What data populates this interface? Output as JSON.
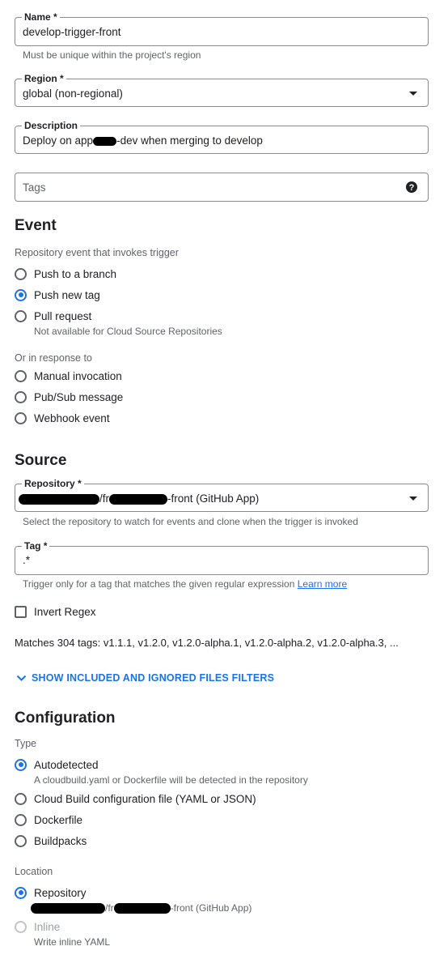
{
  "name_field": {
    "label": "Name *",
    "value": "develop-trigger-front",
    "help": "Must be unique within the project's region"
  },
  "region_field": {
    "label": "Region *",
    "value": "global (non-regional)"
  },
  "description_field": {
    "label": "Description",
    "value_prefix": "Deploy on app",
    "value_suffix": "-dev when merging to develop"
  },
  "tags_field": {
    "placeholder": "Tags",
    "help_icon": "question-circle-icon"
  },
  "event": {
    "title": "Event",
    "subtitle": "Repository event that invokes trigger",
    "options": [
      {
        "label": "Push to a branch",
        "selected": false
      },
      {
        "label": "Push new tag",
        "selected": true
      },
      {
        "label": "Pull request",
        "selected": false,
        "note": "Not available for Cloud Source Repositories"
      }
    ],
    "response_subtitle": "Or in response to",
    "response_options": [
      {
        "label": "Manual invocation",
        "selected": false
      },
      {
        "label": "Pub/Sub message",
        "selected": false
      },
      {
        "label": "Webhook event",
        "selected": false
      }
    ]
  },
  "source": {
    "title": "Source",
    "repository": {
      "label": "Repository *",
      "value_mid": "/fr",
      "value_suffix": "-front (GitHub App)",
      "help": "Select the repository to watch for events and clone when the trigger is invoked"
    },
    "tag": {
      "label": "Tag *",
      "value": ".*",
      "help": "Trigger only for a tag that matches the given regular expression",
      "learn_more": "Learn more"
    },
    "invert_regex": {
      "label": "Invert Regex",
      "checked": false
    },
    "matches": "Matches 304 tags: v1.1.1, v1.2.0, v1.2.0-alpha.1, v1.2.0-alpha.2, v1.2.0-alpha.3, ...",
    "filters_toggle": "SHOW INCLUDED AND IGNORED FILES FILTERS"
  },
  "configuration": {
    "title": "Configuration",
    "type_label": "Type",
    "types": [
      {
        "label": "Autodetected",
        "selected": true,
        "note": "A cloudbuild.yaml or Dockerfile will be detected in the repository"
      },
      {
        "label": "Cloud Build configuration file (YAML or JSON)",
        "selected": false
      },
      {
        "label": "Dockerfile",
        "selected": false
      },
      {
        "label": "Buildpacks",
        "selected": false
      }
    ],
    "location_label": "Location",
    "locations": [
      {
        "label": "Repository",
        "selected": true,
        "note_mid": "/fr",
        "note_suffix": "-front (GitHub App)"
      },
      {
        "label": "Inline",
        "selected": false,
        "disabled": true,
        "note": "Write inline YAML"
      }
    ]
  },
  "colors": {
    "accent": "#1a73e8",
    "text": "#202124",
    "secondary": "#5f6368",
    "border": "#8a8a8a"
  }
}
